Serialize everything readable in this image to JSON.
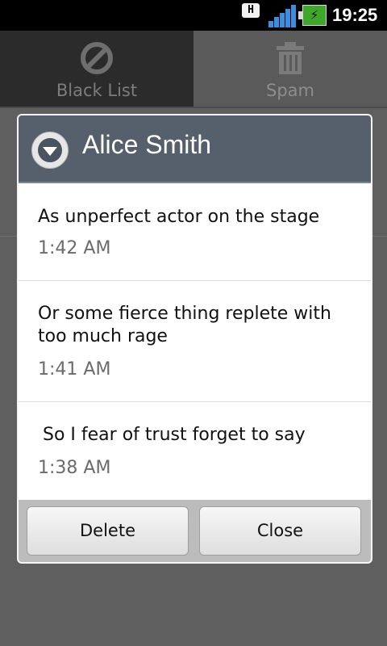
{
  "status_bar": {
    "h_badge": "H",
    "time": "19:25",
    "battery_icon": "battery-charging-icon",
    "signal_icon": "signal-strength-icon"
  },
  "tabs": [
    {
      "label": "Black List",
      "icon": "block-icon",
      "selected": true
    },
    {
      "label": "Spam",
      "icon": "trash-icon",
      "selected": false
    }
  ],
  "dialog": {
    "title": "Alice Smith",
    "header_icon": "chevron-down-circle-icon",
    "messages": [
      {
        "text": "As unperfect actor on the stage",
        "time": "1:42 AM"
      },
      {
        "text": "Or some fierce thing replete with too much rage",
        "time": "1:41 AM"
      },
      {
        "text": "So I fear of trust forget to say",
        "time": "1:38 AM"
      }
    ],
    "buttons": {
      "delete": "Delete",
      "close": "Close"
    }
  },
  "colors": {
    "header_bg": "#56606d",
    "overlay_bg": "#5f5f5f",
    "battery": "#3fa82a",
    "signal": "#3a8fe0"
  }
}
